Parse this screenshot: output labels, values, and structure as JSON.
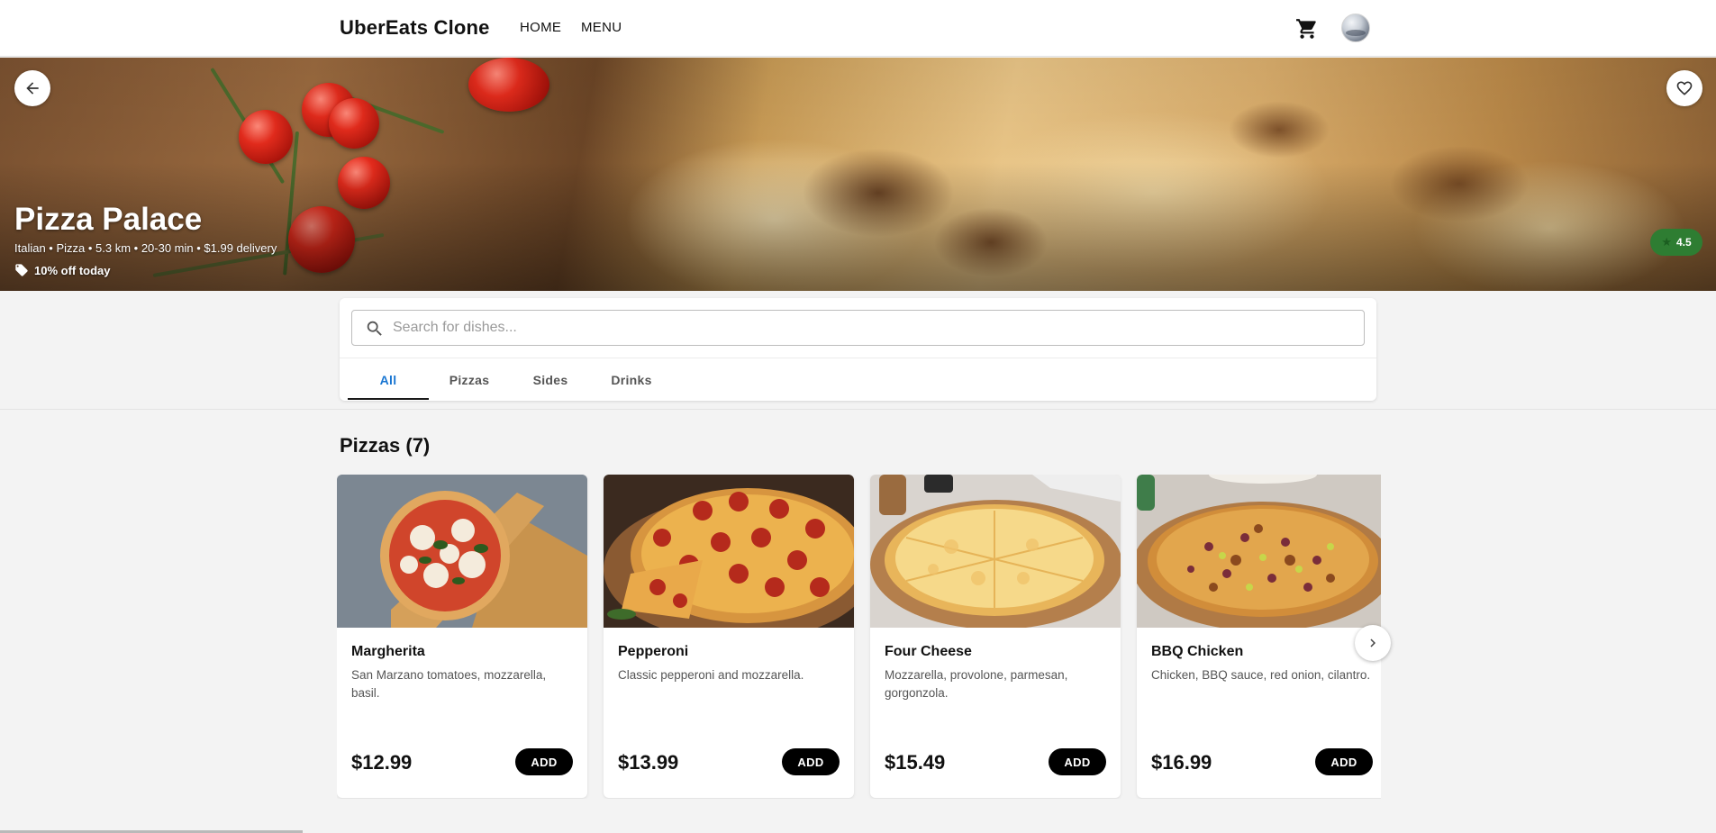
{
  "header": {
    "brand": "UberEats Clone",
    "nav": [
      {
        "label": "HOME"
      },
      {
        "label": "MENU"
      }
    ],
    "cart_icon": "shopping-cart-icon",
    "avatar_icon": "user-avatar"
  },
  "restaurant": {
    "name": "Pizza Palace",
    "meta": "Italian • Pizza • 5.3 km • 20-30 min • $1.99 delivery",
    "promo": "10% off today",
    "rating": "4.5",
    "back_icon": "arrow-left-icon",
    "favorite_icon": "heart-outline-icon"
  },
  "search": {
    "placeholder": "Search for dishes...",
    "value": ""
  },
  "tabs": [
    {
      "label": "All",
      "active": true
    },
    {
      "label": "Pizzas",
      "active": false
    },
    {
      "label": "Sides",
      "active": false
    },
    {
      "label": "Drinks",
      "active": false
    }
  ],
  "section": {
    "title": "Pizzas (7)"
  },
  "items": [
    {
      "name": "Margherita",
      "description": "San Marzano tomatoes, mozzarella, basil.",
      "price": "$12.99",
      "add_label": "ADD"
    },
    {
      "name": "Pepperoni",
      "description": "Classic pepperoni and mozzarella.",
      "price": "$13.99",
      "add_label": "ADD"
    },
    {
      "name": "Four Cheese",
      "description": "Mozzarella, provolone, parmesan, gorgonzola.",
      "price": "$15.49",
      "add_label": "ADD"
    },
    {
      "name": "BBQ Chicken",
      "description": "Chicken, BBQ sauce, red onion, cilantro.",
      "price": "$16.99",
      "add_label": "ADD"
    }
  ],
  "colors": {
    "accent_tab": "#1976d2",
    "rating_badge": "#2e7d32",
    "add_button": "#000000"
  }
}
